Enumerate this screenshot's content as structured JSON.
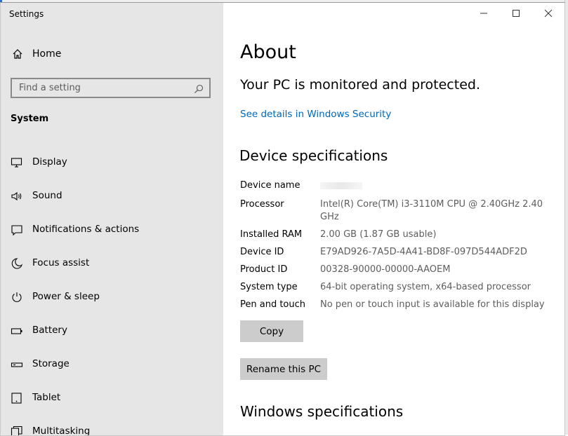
{
  "window": {
    "title": "Settings"
  },
  "sidebar": {
    "home_label": "Home",
    "search_placeholder": "Find a setting",
    "section_title": "System",
    "items": [
      {
        "label": "Display",
        "icon": "monitor-icon"
      },
      {
        "label": "Sound",
        "icon": "speaker-icon"
      },
      {
        "label": "Notifications & actions",
        "icon": "notification-icon"
      },
      {
        "label": "Focus assist",
        "icon": "moon-icon"
      },
      {
        "label": "Power & sleep",
        "icon": "power-icon"
      },
      {
        "label": "Battery",
        "icon": "battery-icon"
      },
      {
        "label": "Storage",
        "icon": "storage-icon"
      },
      {
        "label": "Tablet",
        "icon": "tablet-icon"
      },
      {
        "label": "Multitasking",
        "icon": "multitasking-icon"
      }
    ]
  },
  "main": {
    "title": "About",
    "protection_status": "Your PC is monitored and protected.",
    "security_link": "See details in Windows Security",
    "device_specs_heading": "Device specifications",
    "specs": [
      {
        "key": "Device name",
        "value": ""
      },
      {
        "key": "Processor",
        "value": "Intel(R) Core(TM) i3-3110M CPU @ 2.40GHz   2.40 GHz"
      },
      {
        "key": "Installed RAM",
        "value": "2.00 GB (1.87 GB usable)"
      },
      {
        "key": "Device ID",
        "value": "E79AD926-7A5D-4A41-BD8F-097D544ADF2D"
      },
      {
        "key": "Product ID",
        "value": "00328-90000-00000-AAOEM"
      },
      {
        "key": "System type",
        "value": "64-bit operating system, x64-based processor"
      },
      {
        "key": "Pen and touch",
        "value": "No pen or touch input is available for this display"
      }
    ],
    "copy_button": "Copy",
    "rename_button": "Rename this PC",
    "windows_specs_heading": "Windows specifications"
  },
  "colors": {
    "sidebar_bg": "#e6e6e6",
    "link": "#0067b8",
    "button_bg": "#cccccc",
    "value_text": "#5d5d5d"
  }
}
